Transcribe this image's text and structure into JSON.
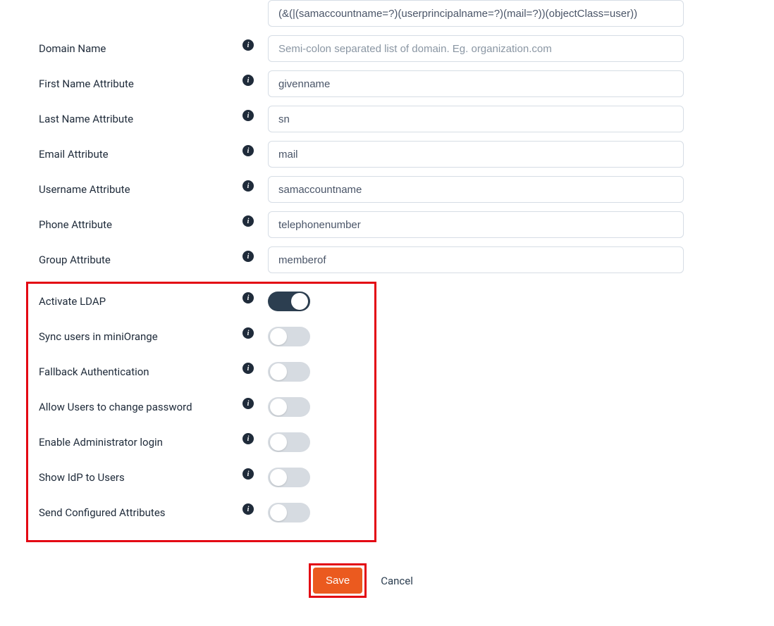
{
  "fields": {
    "ldap_filter": {
      "value": "(&(|(samaccountname=?)(userprincipalname=?)(mail=?))(objectClass=user))"
    },
    "domain_name": {
      "label": "Domain Name",
      "placeholder": "Semi-colon separated list of domain. Eg. organization.com",
      "value": ""
    },
    "first_name_attr": {
      "label": "First Name Attribute",
      "value": "givenname"
    },
    "last_name_attr": {
      "label": "Last Name Attribute",
      "value": "sn"
    },
    "email_attr": {
      "label": "Email Attribute",
      "value": "mail"
    },
    "username_attr": {
      "label": "Username Attribute",
      "value": "samaccountname"
    },
    "phone_attr": {
      "label": "Phone Attribute",
      "value": "telephonenumber"
    },
    "group_attr": {
      "label": "Group Attribute",
      "value": "memberof"
    }
  },
  "toggles": {
    "activate_ldap": {
      "label": "Activate LDAP",
      "on": true
    },
    "sync_users": {
      "label": "Sync users in miniOrange",
      "on": false
    },
    "fallback_auth": {
      "label": "Fallback Authentication",
      "on": false
    },
    "allow_change_pwd": {
      "label": "Allow Users to change password",
      "on": false
    },
    "enable_admin_login": {
      "label": "Enable Administrator login",
      "on": false
    },
    "show_idp": {
      "label": "Show IdP to Users",
      "on": false
    },
    "send_attributes": {
      "label": "Send Configured Attributes",
      "on": false
    }
  },
  "actions": {
    "save": "Save",
    "cancel": "Cancel"
  }
}
